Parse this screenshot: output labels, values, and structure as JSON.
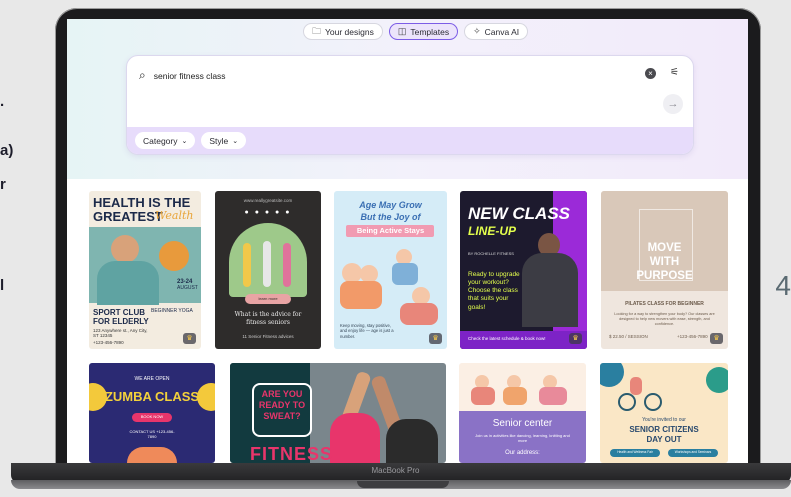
{
  "side_text": {
    "line1": ".",
    "line2": "a)",
    "line3": "r",
    "line4": "l",
    "right_glyph": "4"
  },
  "laptop": {
    "brand": "MacBook Pro"
  },
  "tabs": [
    {
      "label": "Your designs",
      "icon": "folder-icon",
      "active": false
    },
    {
      "label": "Templates",
      "icon": "template-icon",
      "active": true
    },
    {
      "label": "Canva AI",
      "icon": "sparkle-icon",
      "active": false
    }
  ],
  "search": {
    "value": "senior fitness class"
  },
  "filters": [
    {
      "label": "Category"
    },
    {
      "label": "Style"
    }
  ],
  "templates": {
    "t1": {
      "title1": "HEALTH IS THE",
      "title2": "GREATEST",
      "script": "Wealth",
      "date1": "23-24",
      "date2": "AUGUST",
      "club1": "SPORT CLUB",
      "club2": "FOR ELDERLY",
      "tags": "BEGINNER  YOGA",
      "addr": "123 Anywhere st., Any City, ST 12345",
      "phone": "+123-456-7890"
    },
    "t2": {
      "url": "www.reallygreatsite.com",
      "button": "learn more",
      "headline": "What is the advice for fitness seniors",
      "caption": "11 Senior Fitness advices"
    },
    "t3": {
      "line1": "Age May Grow",
      "line2": "But the Joy of",
      "line3": "Being Active Stays",
      "body": "Keep moving, stay positive, and enjoy life — age is just a number."
    },
    "t4": {
      "title1": "NEW CLASS",
      "title2": "LINE-UP",
      "by": "BY ROCHELLE FITNESS",
      "body": "Ready to upgrade your workout? Choose the class that suits your goals!",
      "footer": "Check the latest schedule & book now!"
    },
    "t5": {
      "title1": "MOVE",
      "title2": "WITH",
      "title3": "PURPOSE",
      "sub": "PILATES CLASS FOR BEGINNER",
      "body": "Looking for a way to strengthen your body? Our classes are designed to help new movers with ease, strength, and confidence.",
      "price": "$ 22.50 / SESSION",
      "phone": "+123-456-7890"
    },
    "t6": {
      "top": "WE ARE OPEN",
      "title": "ZUMBA CLASS",
      "button": "BOOK NOW",
      "contact": "CONTACT US +123-456-7890"
    },
    "t7": {
      "bubble1": "ARE YOU",
      "bubble2": "READY TO",
      "bubble3": "SWEAT?",
      "title": "FITNESS"
    },
    "t8": {
      "title": "Senior center",
      "body": "Join us in activities like dancing, learning, knitting and more",
      "addr_label": "Our address:"
    },
    "t9": {
      "invite": "You're invited to our",
      "title1": "SENIOR CITIZENS",
      "title2": "DAY OUT",
      "tag1": "Health and Wellness Fair",
      "tag2": "Workshops and Seminars"
    }
  },
  "colors": {
    "accent": "#7c5ce6",
    "filter_bar": "#e7dcfb",
    "premium": "#f5c84c"
  }
}
